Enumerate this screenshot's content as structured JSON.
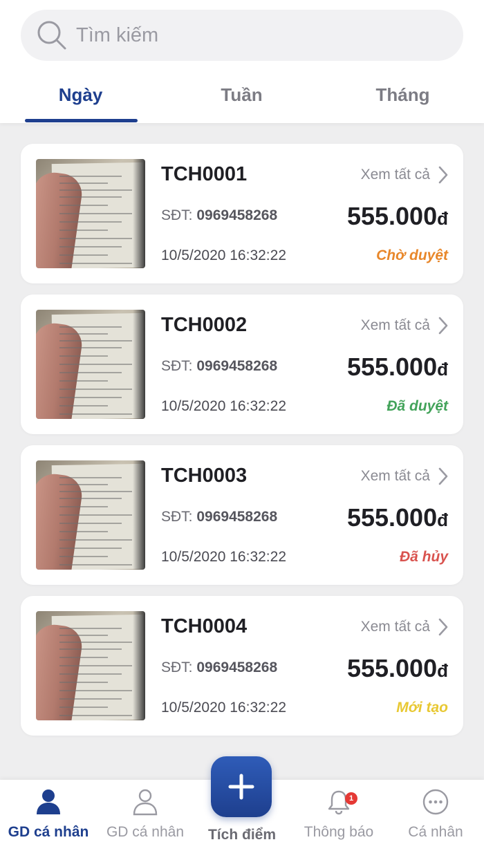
{
  "search": {
    "placeholder": "Tìm kiếm"
  },
  "tabs": [
    {
      "label": "Ngày",
      "active": true
    },
    {
      "label": "Tuần",
      "active": false
    },
    {
      "label": "Tháng",
      "active": false
    }
  ],
  "transactions": [
    {
      "code": "TCH0001",
      "view_all": "Xem tất cả",
      "phone_label": "SĐT:",
      "phone": "0969458268",
      "amount": "555.000",
      "currency": "đ",
      "datetime": "10/5/2020 16:32:22",
      "status": "Chờ duyệt",
      "status_color": "#e8872a"
    },
    {
      "code": "TCH0002",
      "view_all": "Xem tất cả",
      "phone_label": "SĐT:",
      "phone": "0969458268",
      "amount": "555.000",
      "currency": "đ",
      "datetime": "10/5/2020 16:32:22",
      "status": "Đã duyệt",
      "status_color": "#43a35a"
    },
    {
      "code": "TCH0003",
      "view_all": "Xem tất cả",
      "phone_label": "SĐT:",
      "phone": "0969458268",
      "amount": "555.000",
      "currency": "đ",
      "datetime": "10/5/2020 16:32:22",
      "status": "Đã hủy",
      "status_color": "#d9534f"
    },
    {
      "code": "TCH0004",
      "view_all": "Xem tất cả",
      "phone_label": "SĐT:",
      "phone": "0969458268",
      "amount": "555.000",
      "currency": "đ",
      "datetime": "10/5/2020 16:32:22",
      "status": "Mới tạo",
      "status_color": "#e8c832"
    }
  ],
  "bottom_nav": [
    {
      "label": "GD cá nhân",
      "icon": "person-filled-icon",
      "active": true
    },
    {
      "label": "GD cá nhân",
      "icon": "person-outline-icon",
      "active": false
    },
    {
      "label": "Tích điểm",
      "icon": "plus-icon",
      "active": false
    },
    {
      "label": "Thông báo",
      "icon": "bell-icon",
      "active": false,
      "badge": "1"
    },
    {
      "label": "Cá nhân",
      "icon": "more-icon",
      "active": false
    }
  ],
  "colors": {
    "primary": "#1e3f8e",
    "muted": "#9a9aa2",
    "background": "#eeeeef"
  }
}
